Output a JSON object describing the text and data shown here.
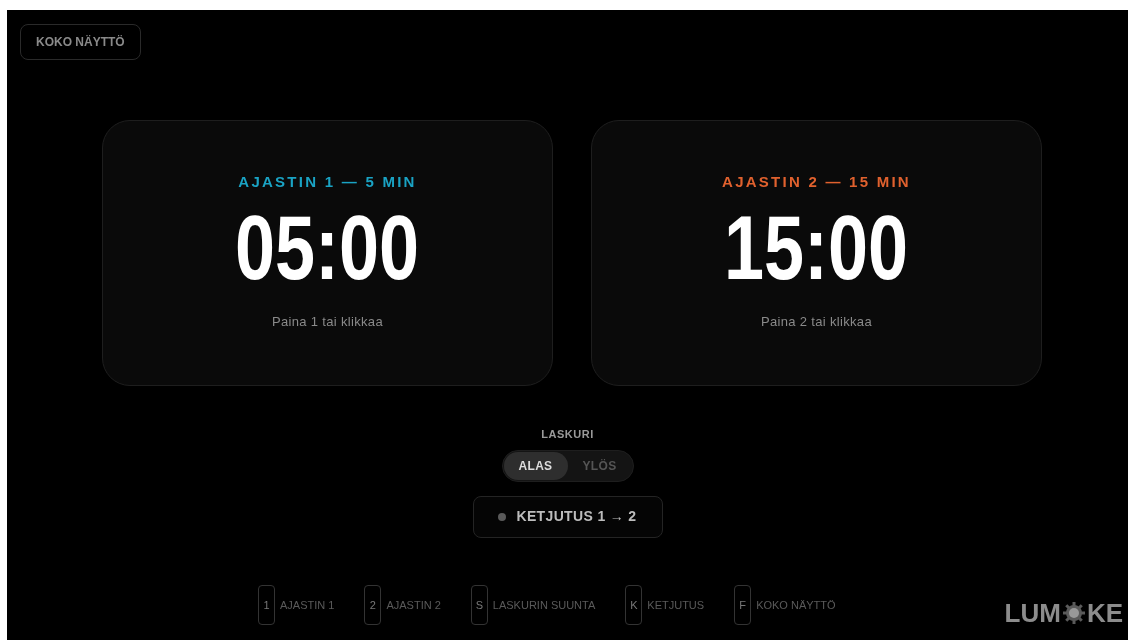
{
  "fullscreen_button": "KOKO NÄYTTÖ",
  "timers": [
    {
      "title": "AJASTIN 1 — 5 MIN",
      "color": "#1aa3c4",
      "time": "05:00",
      "hint": "Paina 1 tai klikkaa"
    },
    {
      "title": "AJASTIN 2 — 15 MIN",
      "color": "#e0612e",
      "time": "15:00",
      "hint": "Paina 2 tai klikkaa"
    }
  ],
  "counter": {
    "label": "LASKURI",
    "options": [
      {
        "label": "ALAS",
        "selected": true
      },
      {
        "label": "YLÖS",
        "selected": false
      }
    ]
  },
  "chain_button": {
    "label": "KETJUTUS 1 → 2",
    "on": false
  },
  "shortcuts": [
    {
      "key": "1",
      "label": "AJASTIN 1"
    },
    {
      "key": "2",
      "label": "AJASTIN 2"
    },
    {
      "key": "S",
      "label": "LASKURIN SUUNTA"
    },
    {
      "key": "K",
      "label": "KETJUTUS"
    },
    {
      "key": "F",
      "label": "KOKO NÄYTTÖ"
    }
  ],
  "logo": {
    "before": "LUM",
    "after": "KE"
  }
}
